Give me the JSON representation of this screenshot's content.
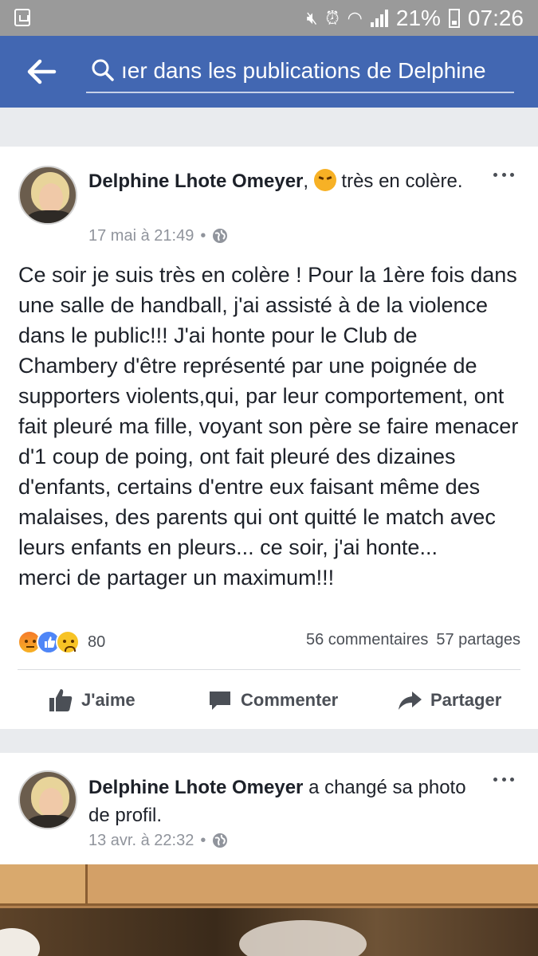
{
  "status_bar": {
    "battery": "21%",
    "time": "07:26"
  },
  "search": {
    "text": "ıer dans les publications de Delphine"
  },
  "posts": [
    {
      "author": "Delphine Lhote Omeyer",
      "feeling": "très en colère.",
      "date": "17 mai à 21:49",
      "separator": "•",
      "text": "Ce soir je suis très en colère ! Pour la 1ère fois dans une salle de handball, j'ai assisté à de la violence dans le public!!! J'ai honte pour le Club de Chambery d'être représenté par une poignée de supporters violents,qui, par leur comportement, ont fait pleuré ma fille, voyant son père se faire menacer d'1 coup de poing, ont fait pleuré des dizaines d'enfants, certains d'entre eux faisant même des malaises, des parents qui ont quitté le match avec leurs enfants en pleurs... ce soir, j'ai honte...\nmerci de partager un maximum!!!",
      "reaction_count": "80",
      "comments": "56 commentaires",
      "shares": "57 partages"
    },
    {
      "author": "Delphine Lhote Omeyer",
      "action": "a changé sa photo de profil.",
      "date": "13 avr. à 22:32",
      "separator": "•"
    }
  ],
  "actions": {
    "like": "J'aime",
    "comment": "Commenter",
    "share": "Partager"
  },
  "colors": {
    "header": "#4267b2",
    "status_bar": "#9a9a9a",
    "background": "#e9ebee"
  },
  "icons": {
    "back": "arrow-left-icon",
    "search": "search-icon",
    "globe": "globe-icon",
    "more": "more-icon",
    "like": "thumbs-up-icon",
    "comment": "comment-icon",
    "share": "share-icon"
  }
}
